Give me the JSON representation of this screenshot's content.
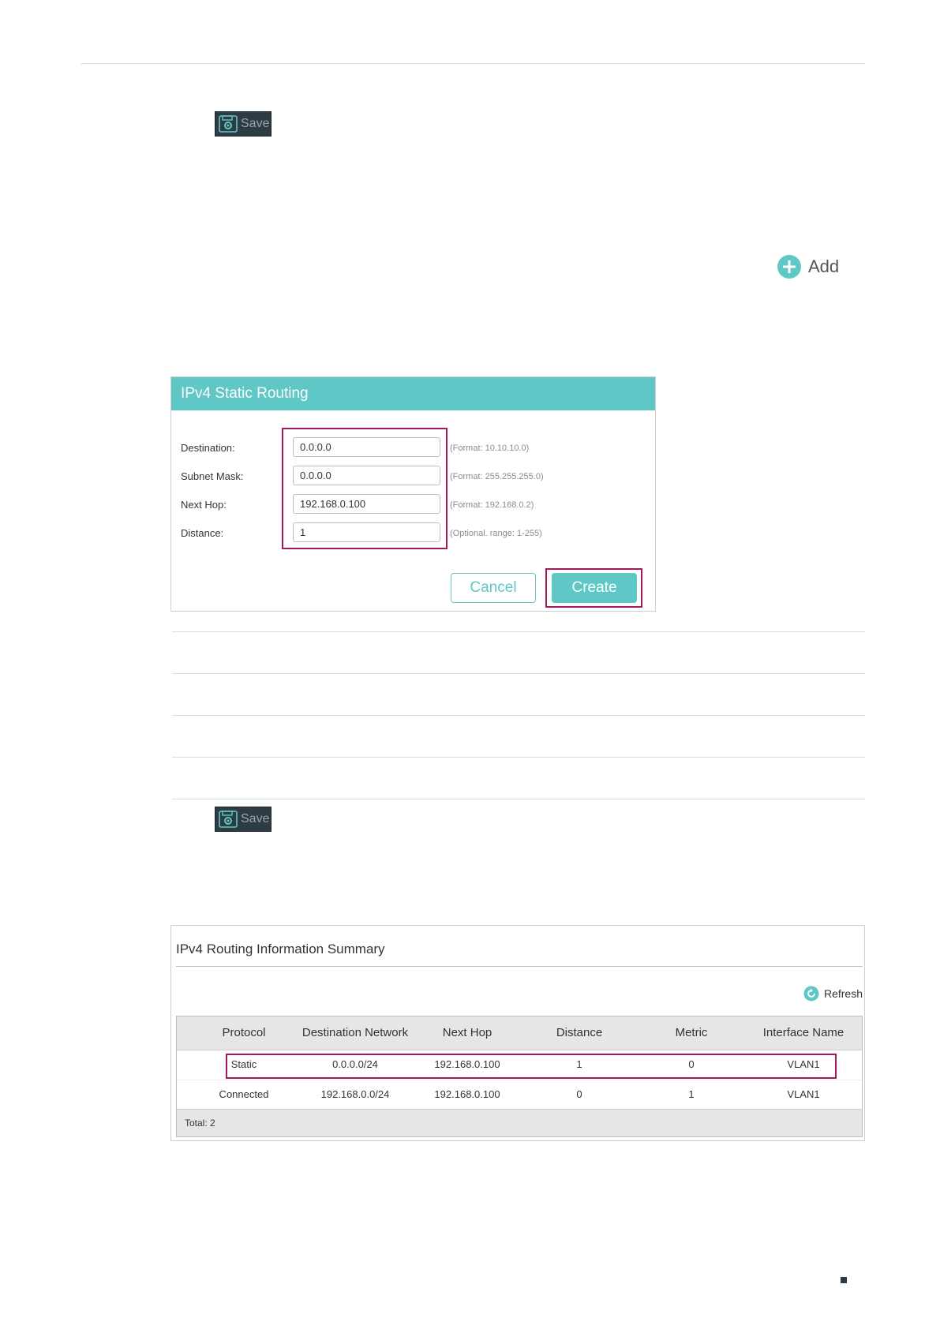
{
  "save_top": {
    "label": "Save",
    "icon": "save-gear-icon"
  },
  "add": {
    "label": "Add",
    "icon": "plus-circle-icon"
  },
  "static_routing": {
    "title": "IPv4 Static Routing",
    "rows": [
      {
        "label": "Destination:",
        "value": "0.0.0.0",
        "hint": "(Format: 10.10.10.0)"
      },
      {
        "label": "Subnet Mask:",
        "value": "0.0.0.0",
        "hint": "(Format: 255.255.255.0)"
      },
      {
        "label": "Next Hop:",
        "value": "192.168.0.100",
        "hint": "(Format: 192.168.0.2)"
      },
      {
        "label": "Distance:",
        "value": "1",
        "hint": "(Optional. range: 1-255)"
      }
    ],
    "cancel_label": "Cancel",
    "create_label": "Create"
  },
  "save_bottom": {
    "label": "Save",
    "icon": "save-gear-icon"
  },
  "summary": {
    "title": "IPv4 Routing Information Summary",
    "refresh_label": "Refresh",
    "columns": [
      "Protocol",
      "Destination Network",
      "Next Hop",
      "Distance",
      "Metric",
      "Interface Name"
    ],
    "rows": [
      [
        "Static",
        "0.0.0.0/24",
        "192.168.0.100",
        "1",
        "0",
        "VLAN1"
      ],
      [
        "Connected",
        "192.168.0.0/24",
        "192.168.0.100",
        "0",
        "1",
        "VLAN1"
      ]
    ],
    "total": "Total: 2"
  },
  "colors": {
    "accent": "#5fc7c5",
    "highlight": "#a3195b",
    "dark": "#2d3b44"
  }
}
